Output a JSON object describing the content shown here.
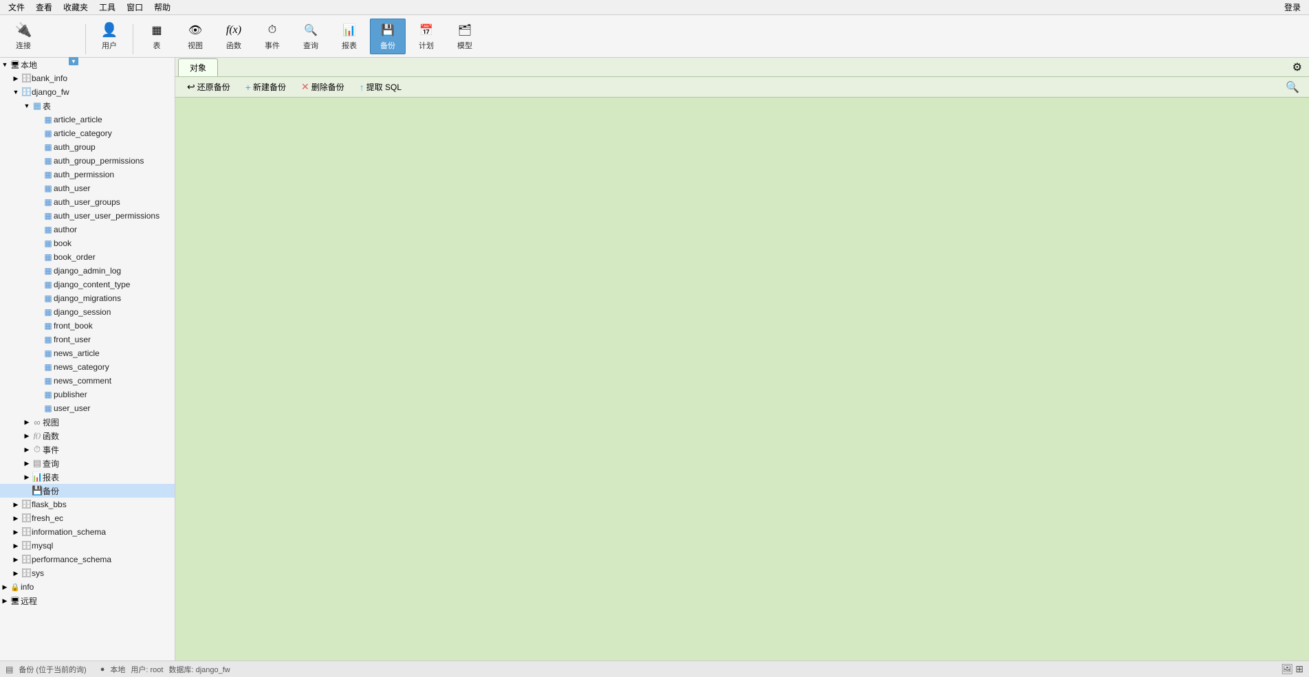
{
  "menubar": {
    "items": [
      "文件",
      "查看",
      "收藏夹",
      "工具",
      "窗口",
      "帮助"
    ]
  },
  "toolbar": {
    "buttons": [
      {
        "id": "connect",
        "label": "连接",
        "icon": "🔌",
        "active": false
      },
      {
        "id": "user",
        "label": "用户",
        "icon": "👤",
        "active": false
      },
      {
        "id": "table",
        "label": "表",
        "icon": "📋",
        "active": false
      },
      {
        "id": "view",
        "label": "视图",
        "icon": "👁",
        "active": false
      },
      {
        "id": "func",
        "label": "函数",
        "icon": "ƒ",
        "active": false
      },
      {
        "id": "event",
        "label": "事件",
        "icon": "⏰",
        "active": false
      },
      {
        "id": "query",
        "label": "查询",
        "icon": "🔍",
        "active": false
      },
      {
        "id": "report",
        "label": "报表",
        "icon": "📊",
        "active": false
      },
      {
        "id": "backup",
        "label": "备份",
        "icon": "💾",
        "active": true
      },
      {
        "id": "plan",
        "label": "计划",
        "icon": "📅",
        "active": false
      },
      {
        "id": "model",
        "label": "模型",
        "icon": "🗂",
        "active": false
      }
    ]
  },
  "sidebar": {
    "local_label": "本地",
    "remote_label": "远程",
    "databases": [
      {
        "id": "bank_info",
        "name": "bank_info",
        "expanded": false
      },
      {
        "id": "django_fw",
        "name": "django_fw",
        "expanded": true,
        "groups": [
          {
            "id": "tables",
            "name": "表",
            "expanded": true,
            "items": [
              "article_article",
              "article_category",
              "auth_group",
              "auth_group_permissions",
              "auth_permission",
              "auth_user",
              "auth_user_groups",
              "auth_user_user_permissions",
              "author",
              "book",
              "book_order",
              "django_admin_log",
              "django_content_type",
              "django_migrations",
              "django_session",
              "front_book",
              "front_user",
              "news_article",
              "news_category",
              "news_comment",
              "publisher",
              "user_user"
            ]
          },
          {
            "id": "views",
            "name": "视图",
            "expanded": false
          },
          {
            "id": "funcs",
            "name": "函数",
            "expanded": false
          },
          {
            "id": "events",
            "name": "事件",
            "expanded": false
          },
          {
            "id": "queries",
            "name": "查询",
            "expanded": false
          },
          {
            "id": "reports",
            "name": "报表",
            "expanded": false
          },
          {
            "id": "backups",
            "name": "备份",
            "expanded": false,
            "selected": true
          }
        ]
      },
      {
        "id": "flask_bbs",
        "name": "flask_bbs",
        "expanded": false
      },
      {
        "id": "fresh_ec",
        "name": "fresh_ec",
        "expanded": false
      },
      {
        "id": "information_schema",
        "name": "information_schema",
        "expanded": false
      },
      {
        "id": "mysql",
        "name": "mysql",
        "expanded": false
      },
      {
        "id": "performance_schema",
        "name": "performance_schema",
        "expanded": false
      },
      {
        "id": "sys",
        "name": "sys",
        "expanded": false
      }
    ],
    "other_items": [
      {
        "id": "info",
        "name": "info"
      }
    ]
  },
  "content": {
    "tabs": [
      {
        "id": "object",
        "label": "对象",
        "active": true
      }
    ],
    "action_buttons": [
      {
        "id": "restore",
        "label": "还原备份",
        "icon": "↩"
      },
      {
        "id": "new-backup",
        "label": "新建备份",
        "icon": "+"
      },
      {
        "id": "delete-backup",
        "label": "删除备份",
        "icon": "✕"
      },
      {
        "id": "extract-sql",
        "label": "提取 SQL",
        "icon": "↑"
      }
    ]
  },
  "statusbar": {
    "left": "备份 (位于当前的询)",
    "connection_icon": "🟢",
    "connection_label": "本地",
    "user_label": "用户: root",
    "db_label": "数据库: django_fw",
    "right_icons": [
      "🖼",
      "⊞"
    ]
  }
}
